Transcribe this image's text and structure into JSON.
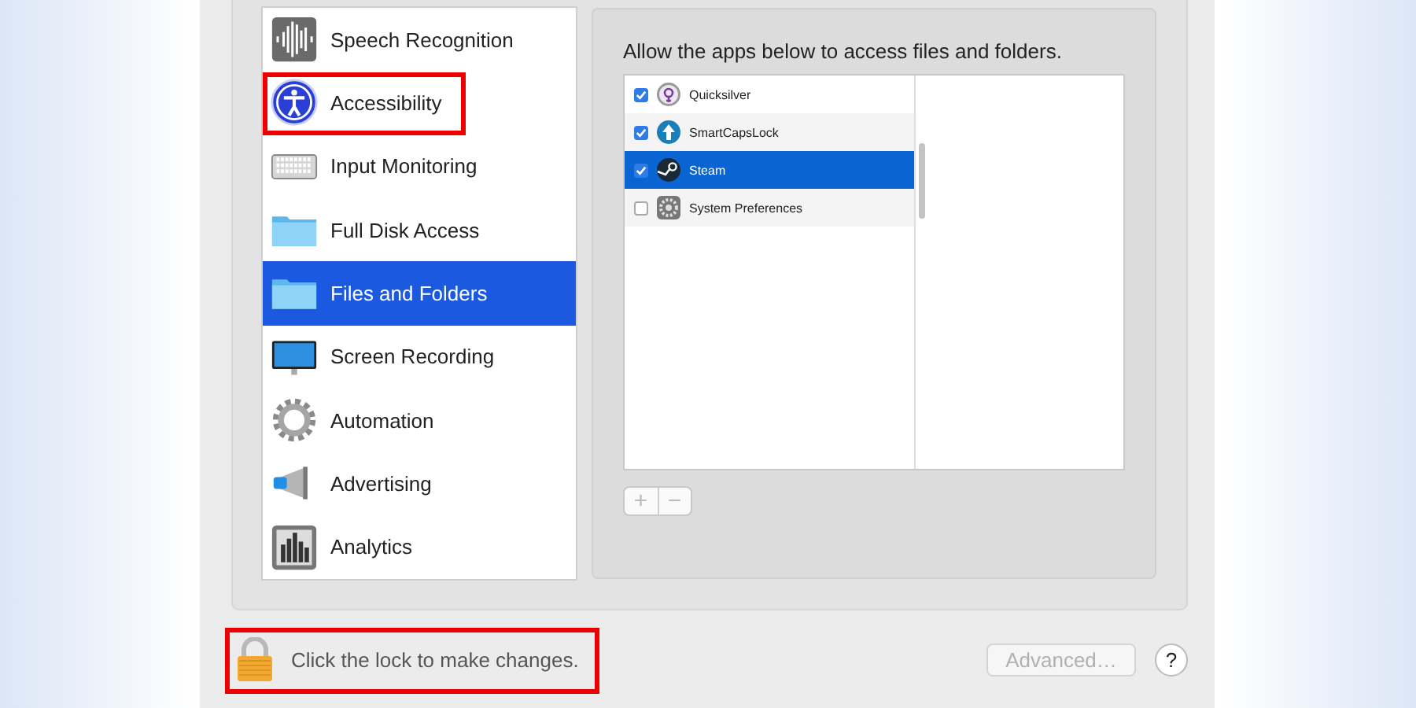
{
  "sidebar": {
    "items": [
      {
        "label": "Speech Recognition",
        "kind": "waveform",
        "selected": false,
        "highlighted": false
      },
      {
        "label": "Accessibility",
        "kind": "accessibility",
        "selected": false,
        "highlighted": true
      },
      {
        "label": "Input Monitoring",
        "kind": "keyboard",
        "selected": false,
        "highlighted": false
      },
      {
        "label": "Full Disk Access",
        "kind": "folder",
        "selected": false,
        "highlighted": false
      },
      {
        "label": "Files and Folders",
        "kind": "folder",
        "selected": true,
        "highlighted": false
      },
      {
        "label": "Screen Recording",
        "kind": "display",
        "selected": false,
        "highlighted": false
      },
      {
        "label": "Automation",
        "kind": "gear",
        "selected": false,
        "highlighted": false
      },
      {
        "label": "Advertising",
        "kind": "megaphone",
        "selected": false,
        "highlighted": false
      },
      {
        "label": "Analytics",
        "kind": "chart",
        "selected": false,
        "highlighted": false
      }
    ]
  },
  "pane": {
    "description": "Allow the apps below to access files and folders.",
    "apps": [
      {
        "name": "Quicksilver",
        "kind": "quicksilver",
        "checked": true,
        "selected": false
      },
      {
        "name": "SmartCapsLock",
        "kind": "uparrow",
        "checked": true,
        "selected": false
      },
      {
        "name": "Steam",
        "kind": "steam",
        "checked": true,
        "selected": true
      },
      {
        "name": "System Preferences",
        "kind": "gear",
        "checked": false,
        "selected": false
      }
    ],
    "add_button": "+",
    "remove_button": "−"
  },
  "footer": {
    "lock_text": "Click the lock to make changes.",
    "highlighted": true,
    "advanced_button": "Advanced…",
    "help_button": "?"
  }
}
